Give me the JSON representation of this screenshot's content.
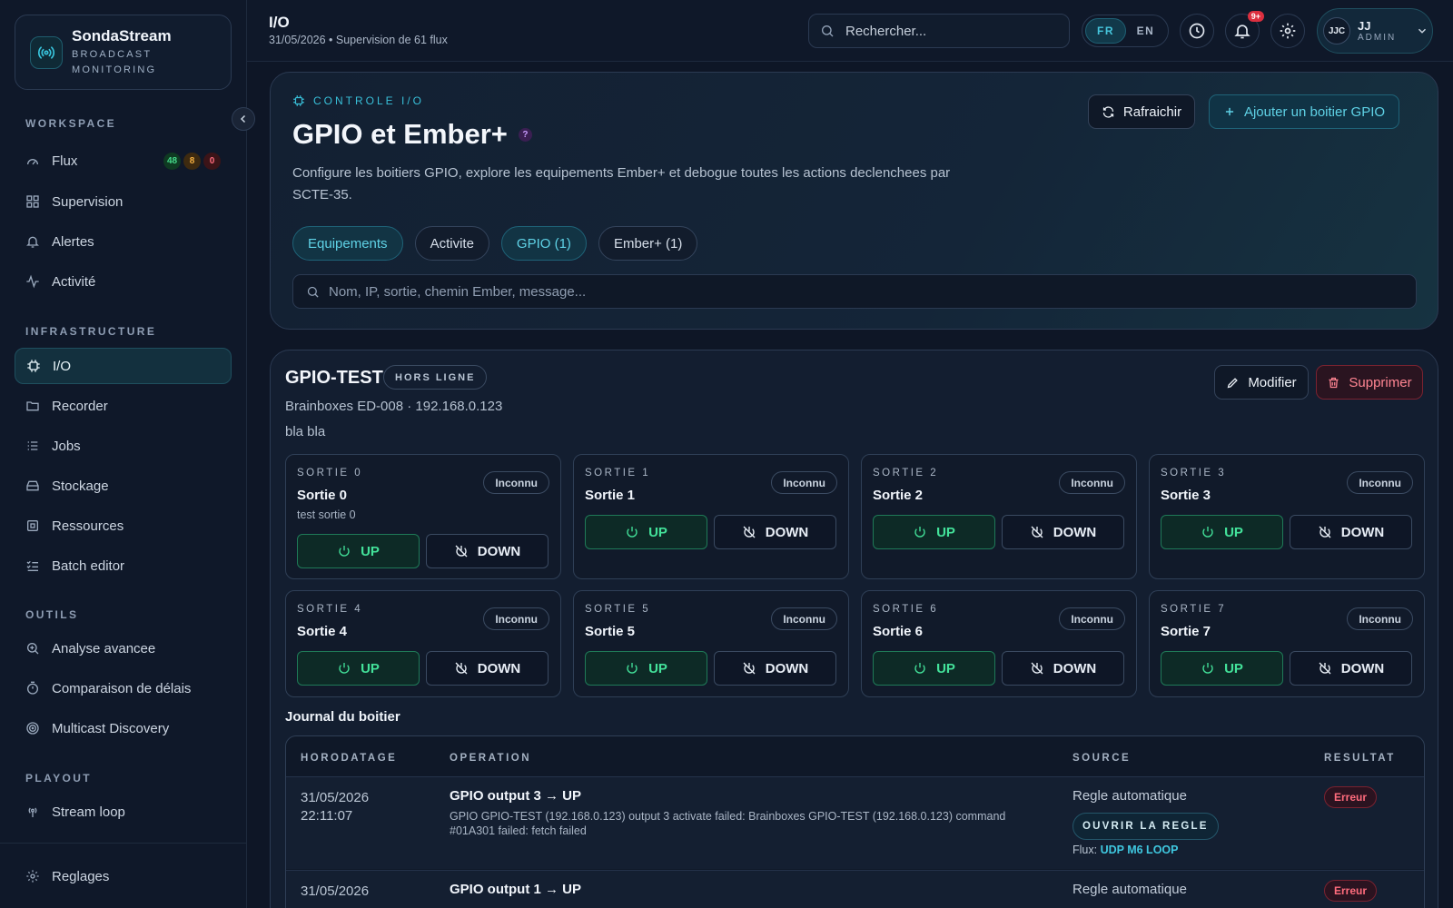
{
  "sidebar": {
    "brand": {
      "name": "SondaStream",
      "subtitle_line1": "BROADCAST",
      "subtitle_line2": "MONITORING"
    },
    "sections": {
      "workspace": "WORKSPACE",
      "infrastructure": "INFRASTRUCTURE",
      "outils": "OUTILS",
      "playout": "PLAYOUT"
    },
    "workspace_items": [
      {
        "label": "Flux",
        "icon": "gauge-icon"
      },
      {
        "label": "Supervision",
        "icon": "grid-icon"
      },
      {
        "label": "Alertes",
        "icon": "bell-icon"
      },
      {
        "label": "Activité",
        "icon": "activity-icon"
      }
    ],
    "flux_badges": [
      {
        "value": "48",
        "color": "#22c55e"
      },
      {
        "value": "8",
        "color": "#f59e0b"
      },
      {
        "value": "0",
        "color": "#ef4444"
      }
    ],
    "infrastructure_items": [
      {
        "label": "I/O",
        "icon": "chip-icon"
      },
      {
        "label": "Recorder",
        "icon": "folder-icon"
      },
      {
        "label": "Jobs",
        "icon": "list-icon"
      },
      {
        "label": "Stockage",
        "icon": "storage-icon"
      },
      {
        "label": "Ressources",
        "icon": "cpu-icon"
      },
      {
        "label": "Batch editor",
        "icon": "checklist-icon"
      }
    ],
    "outils_items": [
      {
        "label": "Analyse avancee",
        "icon": "search-plus-icon"
      },
      {
        "label": "Comparaison de délais",
        "icon": "timer-icon"
      },
      {
        "label": "Multicast Discovery",
        "icon": "radar-icon"
      }
    ],
    "playout_items": [
      {
        "label": "Stream loop",
        "icon": "broadcast-icon"
      }
    ],
    "settings_label": "Reglages"
  },
  "topbar": {
    "title": "I/O",
    "subtitle": "31/05/2026 • Supervision de 61 flux",
    "search_placeholder": "Rechercher...",
    "lang_fr": "FR",
    "lang_en": "EN",
    "notif_count": "9+",
    "user": {
      "initials": "JJC",
      "name": "JJ",
      "role": "ADMIN"
    }
  },
  "hero": {
    "kicker": "CONTROLE I/O",
    "title": "GPIO et Ember+",
    "help": "?",
    "description": "Configure les boitiers GPIO, explore les equipements Ember+ et debogue toutes les actions declenchees par SCTE-35.",
    "refresh_label": "Rafraichir",
    "add_label": "Ajouter un boitier GPIO",
    "tabs": [
      "Equipements",
      "Activite",
      "GPIO (1)",
      "Ember+ (1)"
    ],
    "filter_placeholder": "Nom, IP, sortie, chemin Ember, message..."
  },
  "device": {
    "name": "GPIO-TEST",
    "status": "HORS LIGNE",
    "model": "Brainboxes ED-008 · 192.168.0.123",
    "note": "bla bla",
    "edit_label": "Modifier",
    "delete_label": "Supprimer",
    "outputs": [
      {
        "label": "SORTIE 0",
        "name": "Sortie 0",
        "desc": "test sortie 0",
        "state": "Inconnu"
      },
      {
        "label": "SORTIE 1",
        "name": "Sortie 1",
        "desc": "",
        "state": "Inconnu"
      },
      {
        "label": "SORTIE 2",
        "name": "Sortie 2",
        "desc": "",
        "state": "Inconnu"
      },
      {
        "label": "SORTIE 3",
        "name": "Sortie 3",
        "desc": "",
        "state": "Inconnu"
      },
      {
        "label": "SORTIE 4",
        "name": "Sortie 4",
        "desc": "",
        "state": "Inconnu"
      },
      {
        "label": "SORTIE 5",
        "name": "Sortie 5",
        "desc": "",
        "state": "Inconnu"
      },
      {
        "label": "SORTIE 6",
        "name": "Sortie 6",
        "desc": "",
        "state": "Inconnu"
      },
      {
        "label": "SORTIE 7",
        "name": "Sortie 7",
        "desc": "",
        "state": "Inconnu"
      }
    ],
    "up_label": "UP",
    "down_label": "DOWN"
  },
  "journal": {
    "title": "Journal du boitier",
    "headers": {
      "timestamp": "HORODATAGE",
      "operation": "OPERATION",
      "source": "SOURCE",
      "result": "RESULTAT"
    },
    "rows": [
      {
        "date": "31/05/2026",
        "time": "22:11:07",
        "operation": "GPIO output 3 → UP",
        "detail": "GPIO GPIO-TEST (192.168.0.123) output 3 activate failed: Brainboxes GPIO-TEST (192.168.0.123) command #01A301 failed: fetch failed",
        "source": "Regle automatique",
        "rule_label": "OUVRIR LA REGLE",
        "flux_prefix": "Flux:",
        "flux_name": "UDP M6 LOOP",
        "result": "Erreur"
      },
      {
        "date": "31/05/2026",
        "time": "",
        "operation": "GPIO output 1 → UP",
        "detail": "",
        "source": "Regle automatique",
        "result": "Erreur"
      }
    ]
  },
  "colors": {
    "accent": "#38c4dc",
    "up": "#43e29a",
    "error": "#ff6c7d",
    "background": "#0e1626"
  }
}
